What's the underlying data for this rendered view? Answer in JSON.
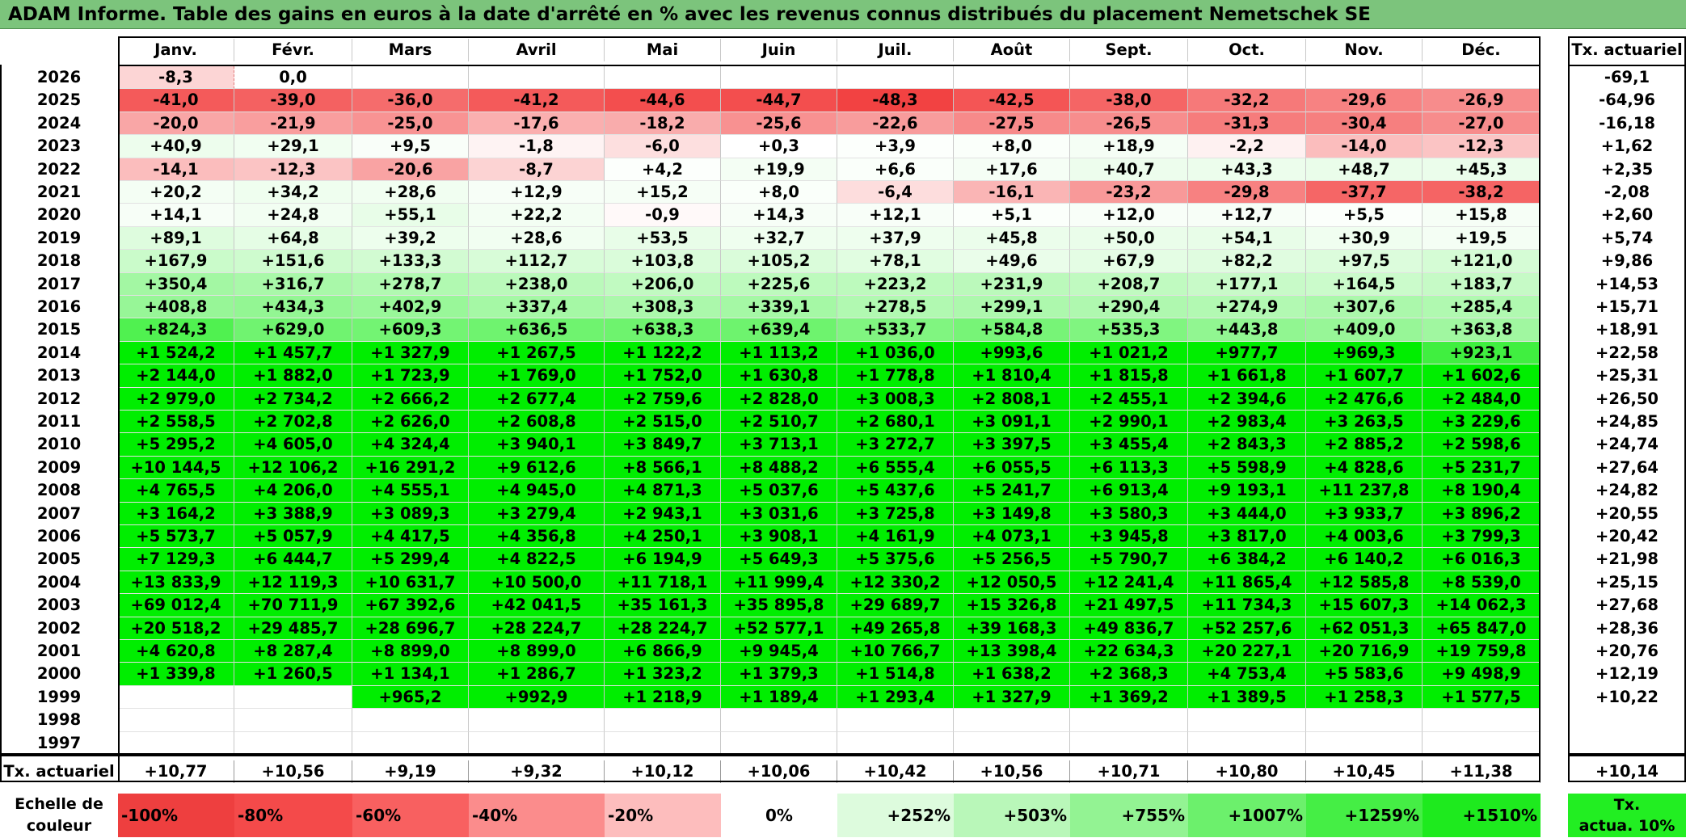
{
  "title": "ADAM Informe. Table des gains en euros à la date d'arrêté en % avec les revenus connus distribués du placement Nemetschek SE",
  "chart_data": {
    "type": "heatmap",
    "months": [
      "Janv.",
      "Févr.",
      "Mars",
      "Avril",
      "Mai",
      "Juin",
      "Juil.",
      "Août",
      "Sept.",
      "Oct.",
      "Nov.",
      "Déc."
    ],
    "annual_header": "Tx. actuariel",
    "rows": [
      {
        "year": "2026",
        "values": [
          "-8,3",
          "0,0",
          "",
          "",
          "",
          "",
          "",
          "",
          "",
          "",
          "",
          ""
        ],
        "rate": "-69,1"
      },
      {
        "year": "2025",
        "values": [
          "-41,0",
          "-39,0",
          "-36,0",
          "-41,2",
          "-44,6",
          "-44,7",
          "-48,3",
          "-42,5",
          "-38,0",
          "-32,2",
          "-29,6",
          "-26,9"
        ],
        "rate": "-64,96"
      },
      {
        "year": "2024",
        "values": [
          "-20,0",
          "-21,9",
          "-25,0",
          "-17,6",
          "-18,2",
          "-25,6",
          "-22,6",
          "-27,5",
          "-26,5",
          "-31,3",
          "-30,4",
          "-27,0"
        ],
        "rate": "-16,18"
      },
      {
        "year": "2023",
        "values": [
          "+40,9",
          "+29,1",
          "+9,5",
          "-1,8",
          "-6,0",
          "+0,3",
          "+3,9",
          "+8,0",
          "+18,9",
          "-2,2",
          "-14,0",
          "-12,3"
        ],
        "rate": "+1,62"
      },
      {
        "year": "2022",
        "values": [
          "-14,1",
          "-12,3",
          "-20,6",
          "-8,7",
          "+4,2",
          "+19,9",
          "+6,6",
          "+17,6",
          "+40,7",
          "+43,3",
          "+48,7",
          "+45,3"
        ],
        "rate": "+2,35"
      },
      {
        "year": "2021",
        "values": [
          "+20,2",
          "+34,2",
          "+28,6",
          "+12,9",
          "+15,2",
          "+8,0",
          "-6,4",
          "-16,1",
          "-23,2",
          "-29,8",
          "-37,7",
          "-38,2"
        ],
        "rate": "-2,08"
      },
      {
        "year": "2020",
        "values": [
          "+14,1",
          "+24,8",
          "+55,1",
          "+22,2",
          "-0,9",
          "+14,3",
          "+12,1",
          "+5,1",
          "+12,0",
          "+12,7",
          "+5,5",
          "+15,8"
        ],
        "rate": "+2,60"
      },
      {
        "year": "2019",
        "values": [
          "+89,1",
          "+64,8",
          "+39,2",
          "+28,6",
          "+53,5",
          "+32,7",
          "+37,9",
          "+45,8",
          "+50,0",
          "+54,1",
          "+30,9",
          "+19,5"
        ],
        "rate": "+5,74"
      },
      {
        "year": "2018",
        "values": [
          "+167,9",
          "+151,6",
          "+133,3",
          "+112,7",
          "+103,8",
          "+105,2",
          "+78,1",
          "+49,6",
          "+67,9",
          "+82,2",
          "+97,5",
          "+121,0"
        ],
        "rate": "+9,86"
      },
      {
        "year": "2017",
        "values": [
          "+350,4",
          "+316,7",
          "+278,7",
          "+238,0",
          "+206,0",
          "+225,6",
          "+223,2",
          "+231,9",
          "+208,7",
          "+177,1",
          "+164,5",
          "+183,7"
        ],
        "rate": "+14,53"
      },
      {
        "year": "2016",
        "values": [
          "+408,8",
          "+434,3",
          "+402,9",
          "+337,4",
          "+308,3",
          "+339,1",
          "+278,5",
          "+299,1",
          "+290,4",
          "+274,9",
          "+307,6",
          "+285,4"
        ],
        "rate": "+15,71"
      },
      {
        "year": "2015",
        "values": [
          "+824,3",
          "+629,0",
          "+609,3",
          "+636,5",
          "+638,3",
          "+639,4",
          "+533,7",
          "+584,8",
          "+535,3",
          "+443,8",
          "+409,0",
          "+363,8"
        ],
        "rate": "+18,91"
      },
      {
        "year": "2014",
        "values": [
          "+1 524,2",
          "+1 457,7",
          "+1 327,9",
          "+1 267,5",
          "+1 122,2",
          "+1 113,2",
          "+1 036,0",
          "+993,6",
          "+1 021,2",
          "+977,7",
          "+969,3",
          "+923,1"
        ],
        "rate": "+22,58"
      },
      {
        "year": "2013",
        "values": [
          "+2 144,0",
          "+1 882,0",
          "+1 723,9",
          "+1 769,0",
          "+1 752,0",
          "+1 630,8",
          "+1 778,8",
          "+1 810,4",
          "+1 815,8",
          "+1 661,8",
          "+1 607,7",
          "+1 602,6"
        ],
        "rate": "+25,31"
      },
      {
        "year": "2012",
        "values": [
          "+2 979,0",
          "+2 734,2",
          "+2 666,2",
          "+2 677,4",
          "+2 759,6",
          "+2 828,0",
          "+3 008,3",
          "+2 808,1",
          "+2 455,1",
          "+2 394,6",
          "+2 476,6",
          "+2 484,0"
        ],
        "rate": "+26,50"
      },
      {
        "year": "2011",
        "values": [
          "+2 558,5",
          "+2 702,8",
          "+2 626,0",
          "+2 608,8",
          "+2 515,0",
          "+2 510,7",
          "+2 680,1",
          "+3 091,1",
          "+2 990,1",
          "+2 983,4",
          "+3 263,5",
          "+3 229,6"
        ],
        "rate": "+24,85"
      },
      {
        "year": "2010",
        "values": [
          "+5 295,2",
          "+4 605,0",
          "+4 324,4",
          "+3 940,1",
          "+3 849,7",
          "+3 713,1",
          "+3 272,7",
          "+3 397,5",
          "+3 455,4",
          "+2 843,3",
          "+2 885,2",
          "+2 598,6"
        ],
        "rate": "+24,74"
      },
      {
        "year": "2009",
        "values": [
          "+10 144,5",
          "+12 106,2",
          "+16 291,2",
          "+9 612,6",
          "+8 566,1",
          "+8 488,2",
          "+6 555,4",
          "+6 055,5",
          "+6 113,3",
          "+5 598,9",
          "+4 828,6",
          "+5 231,7"
        ],
        "rate": "+27,64"
      },
      {
        "year": "2008",
        "values": [
          "+4 765,5",
          "+4 206,0",
          "+4 555,1",
          "+4 945,0",
          "+4 871,3",
          "+5 037,6",
          "+5 437,6",
          "+5 241,7",
          "+6 913,4",
          "+9 193,1",
          "+11 237,8",
          "+8 190,4"
        ],
        "rate": "+24,82"
      },
      {
        "year": "2007",
        "values": [
          "+3 164,2",
          "+3 388,9",
          "+3 089,3",
          "+3 279,4",
          "+2 943,1",
          "+3 031,6",
          "+3 725,8",
          "+3 149,8",
          "+3 580,3",
          "+3 444,0",
          "+3 933,7",
          "+3 896,2"
        ],
        "rate": "+20,55"
      },
      {
        "year": "2006",
        "values": [
          "+5 573,7",
          "+5 057,9",
          "+4 417,5",
          "+4 356,8",
          "+4 250,1",
          "+3 908,1",
          "+4 161,9",
          "+4 073,1",
          "+3 945,8",
          "+3 817,0",
          "+4 003,6",
          "+3 799,3"
        ],
        "rate": "+20,42"
      },
      {
        "year": "2005",
        "values": [
          "+7 129,3",
          "+6 444,7",
          "+5 299,4",
          "+4 822,5",
          "+6 194,9",
          "+5 649,3",
          "+5 375,6",
          "+5 256,5",
          "+5 790,7",
          "+6 384,2",
          "+6 140,2",
          "+6 016,3"
        ],
        "rate": "+21,98"
      },
      {
        "year": "2004",
        "values": [
          "+13 833,9",
          "+12 119,3",
          "+10 631,7",
          "+10 500,0",
          "+11 718,1",
          "+11 999,4",
          "+12 330,2",
          "+12 050,5",
          "+12 241,4",
          "+11 865,4",
          "+12 585,8",
          "+8 539,0"
        ],
        "rate": "+25,15"
      },
      {
        "year": "2003",
        "values": [
          "+69 012,4",
          "+70 711,9",
          "+67 392,6",
          "+42 041,5",
          "+35 161,3",
          "+35 895,8",
          "+29 689,7",
          "+15 326,8",
          "+21 497,5",
          "+11 734,3",
          "+15 607,3",
          "+14 062,3"
        ],
        "rate": "+27,68"
      },
      {
        "year": "2002",
        "values": [
          "+20 518,2",
          "+29 485,7",
          "+28 696,7",
          "+28 224,7",
          "+28 224,7",
          "+52 577,1",
          "+49 265,8",
          "+39 168,3",
          "+49 836,7",
          "+52 257,6",
          "+62 051,3",
          "+65 847,0"
        ],
        "rate": "+28,36"
      },
      {
        "year": "2001",
        "values": [
          "+4 620,8",
          "+8 287,4",
          "+8 899,0",
          "+8 899,0",
          "+6 866,9",
          "+9 945,4",
          "+10 766,7",
          "+13 398,4",
          "+22 634,3",
          "+20 227,1",
          "+20 716,9",
          "+19 759,8"
        ],
        "rate": "+20,76"
      },
      {
        "year": "2000",
        "values": [
          "+1 339,8",
          "+1 260,5",
          "+1 134,1",
          "+1 286,7",
          "+1 323,2",
          "+1 379,3",
          "+1 514,8",
          "+1 638,2",
          "+2 368,3",
          "+4 753,4",
          "+5 583,6",
          "+9 498,9"
        ],
        "rate": "+12,19"
      },
      {
        "year": "1999",
        "values": [
          "",
          "",
          "+965,2",
          "+992,9",
          "+1 218,9",
          "+1 189,4",
          "+1 293,4",
          "+1 327,9",
          "+1 369,2",
          "+1 389,5",
          "+1 258,3",
          "+1 577,5"
        ],
        "rate": "+10,22"
      },
      {
        "year": "1998",
        "values": [
          "",
          "",
          "",
          "",
          "",
          "",
          "",
          "",
          "",
          "",
          "",
          ""
        ],
        "rate": ""
      },
      {
        "year": "1997",
        "values": [
          "",
          "",
          "",
          "",
          "",
          "",
          "",
          "",
          "",
          "",
          "",
          ""
        ],
        "rate": ""
      }
    ],
    "footer": {
      "label": "Tx. actuariel",
      "values": [
        "+10,77",
        "+10,56",
        "+9,19",
        "+9,32",
        "+10,12",
        "+10,06",
        "+10,42",
        "+10,56",
        "+10,71",
        "+10,80",
        "+10,45",
        "+11,38"
      ],
      "rate": "+10,14"
    },
    "color_scale": {
      "label_line1": "Echelle de",
      "label_line2": "couleur",
      "stops": [
        {
          "label": "-100%",
          "value": -100,
          "color": "#ee3f3f"
        },
        {
          "label": "-80%",
          "value": -80,
          "color": "#f44a4a"
        },
        {
          "label": "-60%",
          "value": -60,
          "color": "#f86060"
        },
        {
          "label": "-40%",
          "value": -40,
          "color": "#fb8c8c"
        },
        {
          "label": "-20%",
          "value": -20,
          "color": "#fdbdbd"
        },
        {
          "label": "0%",
          "value": 0,
          "color": "#ffffff"
        },
        {
          "label": "+252%",
          "value": 252,
          "color": "#ddfbdd"
        },
        {
          "label": "+503%",
          "value": 503,
          "color": "#b9f7b9"
        },
        {
          "label": "+755%",
          "value": 755,
          "color": "#93f393"
        },
        {
          "label": "+1007%",
          "value": 1007,
          "color": "#6cf06c"
        },
        {
          "label": "+1259%",
          "value": 1259,
          "color": "#45ee45"
        },
        {
          "label": "+1510%",
          "value": 1510,
          "color": "#1eea1e"
        }
      ],
      "rate_cell_line1": "Tx.",
      "rate_cell_line2": "actua. 10%",
      "rate_cell_color": "#22ee22"
    }
  }
}
